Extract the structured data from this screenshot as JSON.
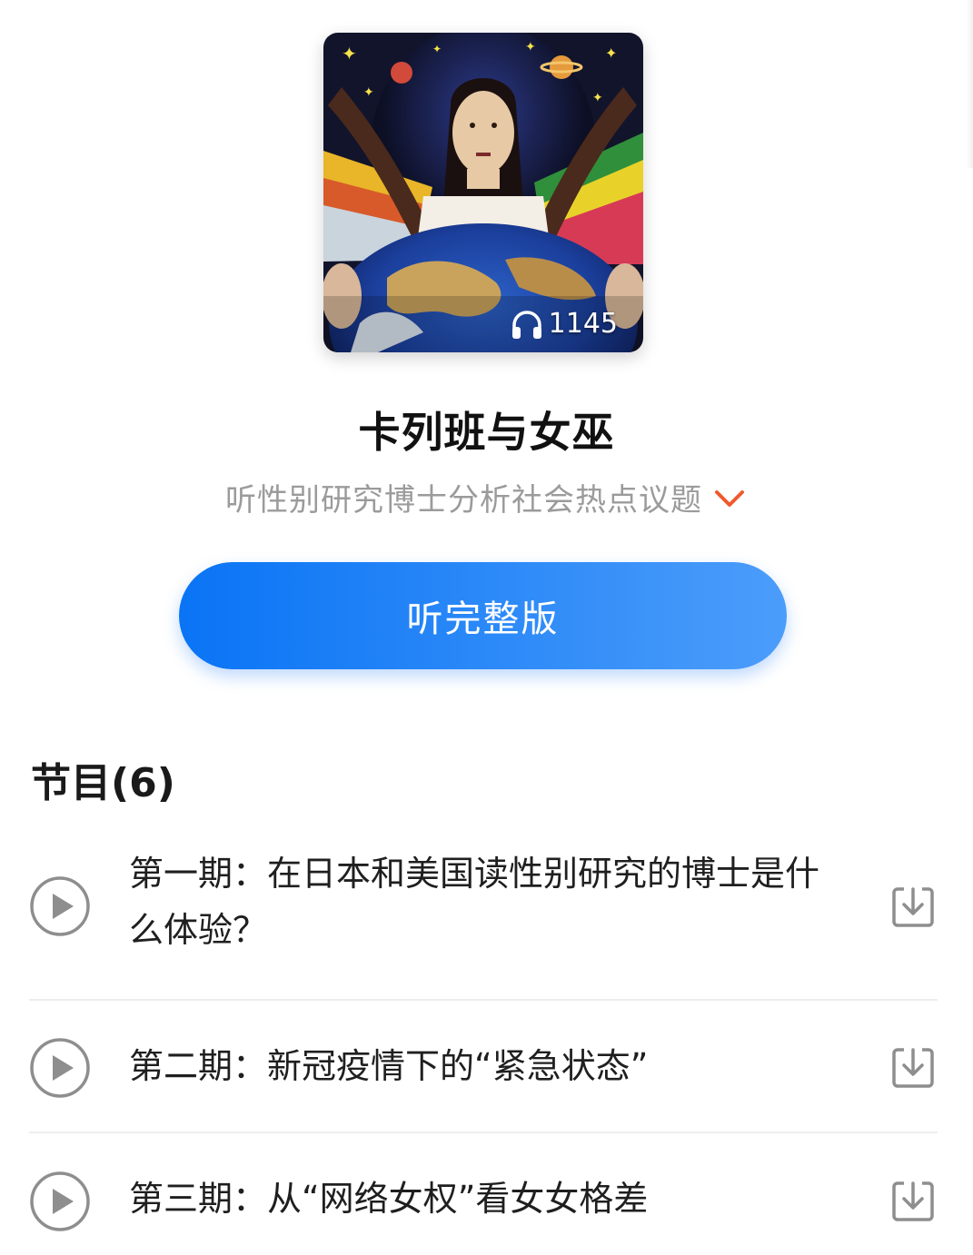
{
  "album": {
    "play_count": "1145",
    "title": "卡列班与女巫",
    "subtitle": "听性别研究博士分析社会热点议题",
    "listen_full_label": "听完整版"
  },
  "section": {
    "heading": "节目(6)"
  },
  "episodes": [
    {
      "title": "第一期：在日本和美国读性别研究的博士是什么体验？"
    },
    {
      "title": "第二期：新冠疫情下的“紧急状态”"
    },
    {
      "title": "第三期：从“网络女权”看女女格差"
    }
  ],
  "colors": {
    "accent_blue": "#0a74f5",
    "chevron_orange": "#ef5a2c",
    "muted_text": "#9b9b9b"
  },
  "icons": {
    "headphones": "headphones-icon",
    "chevron": "chevron-down-icon",
    "play": "play-circle-icon",
    "download": "download-icon"
  }
}
